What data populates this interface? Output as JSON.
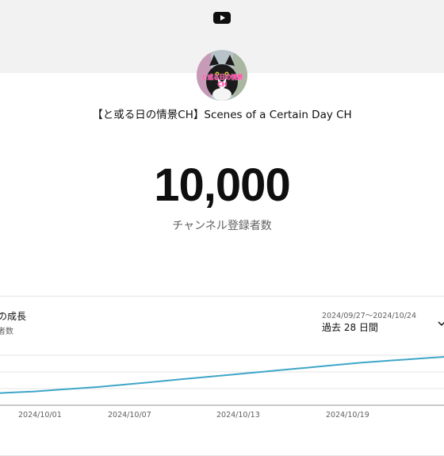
{
  "header": {
    "logo_icon": "youtube-play-icon",
    "channel_name": "【と或る日の情景CH】Scenes of a Certain Day CH",
    "avatar_text": "と或る日の情景CH"
  },
  "milestone": {
    "subscriber_count": "10,000",
    "subscriber_label": "チャンネル登録者数"
  },
  "growth_card": {
    "title": "の成長",
    "subtitle": "者数",
    "date_range": "2024/09/27～2024/10/24",
    "period": "過去 28 日間",
    "dropdown_icon": "chevron-down-icon"
  },
  "chart_data": {
    "type": "line",
    "x_tick_labels": [
      "2024/10/01",
      "2024/10/07",
      "2024/10/13",
      "2024/10/19"
    ],
    "series_color": "#3ea6c7",
    "grid": true,
    "series": [
      {
        "values": [
          0.05,
          0.07,
          0.09,
          0.12,
          0.15,
          0.18,
          0.21,
          0.25,
          0.29,
          0.33,
          0.37,
          0.41,
          0.45,
          0.49,
          0.53,
          0.57,
          0.61,
          0.65,
          0.69,
          0.73,
          0.77,
          0.81,
          0.85,
          0.88,
          0.91,
          0.94,
          0.97,
          1.0
        ]
      }
    ]
  }
}
